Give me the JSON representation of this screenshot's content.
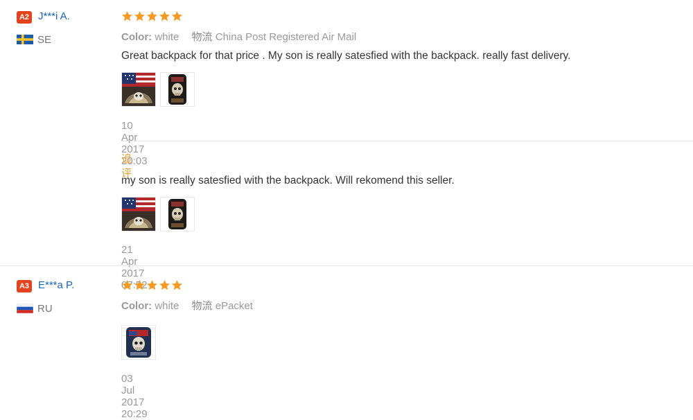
{
  "reviews": [
    {
      "level": "A2",
      "buyer_name": "J***i A.",
      "country": "SE",
      "flag_icon": "sweden-flag-icon",
      "rating": 5,
      "color_label": "Color:",
      "color_value": "white",
      "shipping_label": "物流",
      "shipping_value": "China Post Registered Air Mail",
      "text": "Great backpack for that price . My son is really satesfied with the backpack. really fast delivery.",
      "photos": [
        "backpack-flag-photo",
        "backpack-skull-photo"
      ],
      "date": "10 Apr 2017 20:03",
      "additional": {
        "label": "追评",
        "text": "my son is really satesfied with the backpack. Will rekomend this seller.",
        "photos": [
          "backpack-flag-photo",
          "backpack-skull-photo"
        ],
        "date": "21 Apr 2017 07:52"
      }
    },
    {
      "level": "A3",
      "buyer_name": "E***a P.",
      "country": "RU",
      "flag_icon": "russia-flag-icon",
      "rating": 5,
      "color_label": "Color:",
      "color_value": "white",
      "shipping_label": "物流",
      "shipping_value": "ePacket",
      "photos": [
        "backpack-skull-blue-photo"
      ],
      "date": "03 Jul 2017 20:29"
    }
  ],
  "colors": {
    "star": "#f59a23",
    "link": "#1d64b6",
    "badge": "#e3431f",
    "followup": "#e6a23c"
  }
}
